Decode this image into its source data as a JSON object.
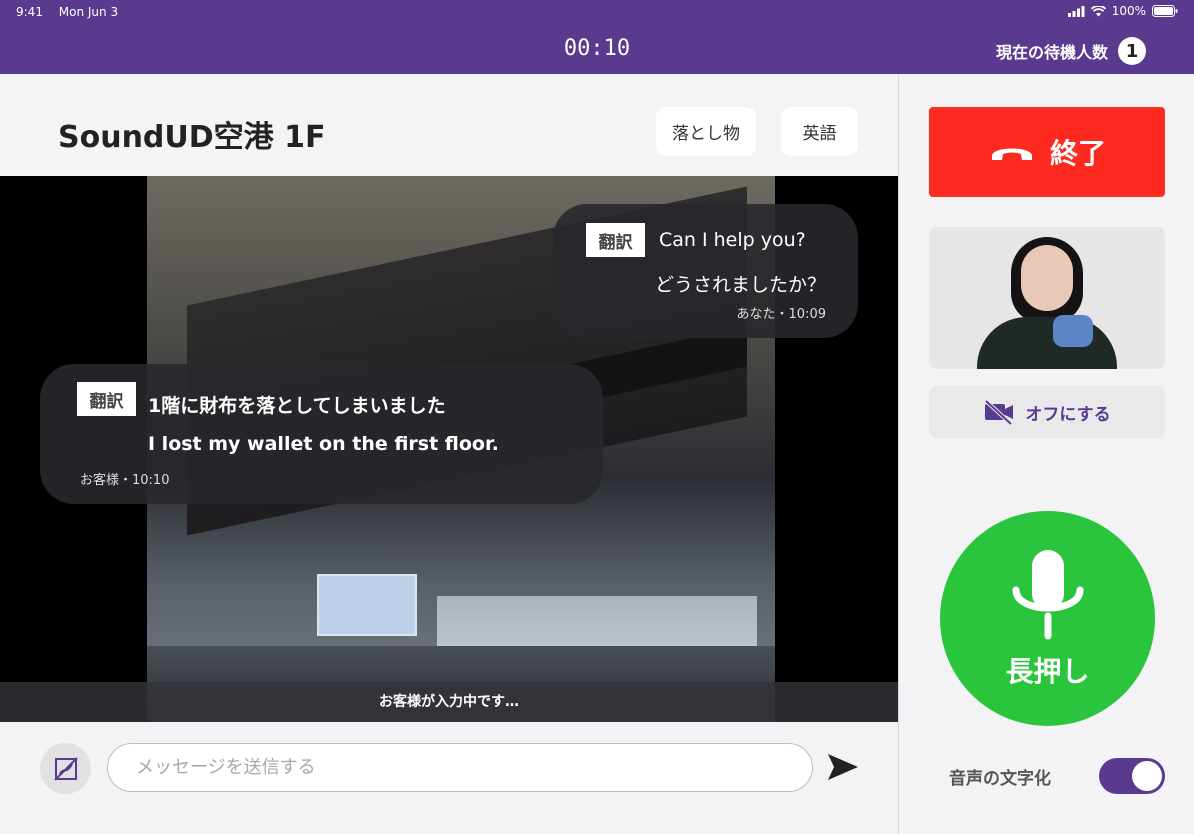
{
  "status_bar": {
    "time": "9:41",
    "date": "Mon Jun 3",
    "battery": "100%"
  },
  "top_bar": {
    "timer": "00:10",
    "queue_label": "現在の待機人数",
    "queue_count": "1"
  },
  "header": {
    "title": "SoundUD空港 1F",
    "chips": [
      "落とし物",
      "英語"
    ]
  },
  "messages": [
    {
      "tag": "翻訳",
      "line1": "Can I help you?",
      "line2": "どうされましたか？",
      "meta": "あなた・10:09"
    },
    {
      "tag": "翻訳",
      "line1": "1階に財布を落としてしまいました",
      "line2": "I lost my wallet on the first floor.",
      "meta": "お客様・10:10"
    }
  ],
  "typing_indicator": "お客様が入力中です…",
  "composer": {
    "placeholder": "メッセージを送信する"
  },
  "side": {
    "end_label": "終了",
    "camera_off_label": "オフにする",
    "mic_label": "長押し",
    "transcription_label": "音声の文字化",
    "transcription_on": true
  },
  "colors": {
    "brand": "#5a3a8e",
    "end": "#ff2a1f",
    "mic": "#2ac53c"
  }
}
